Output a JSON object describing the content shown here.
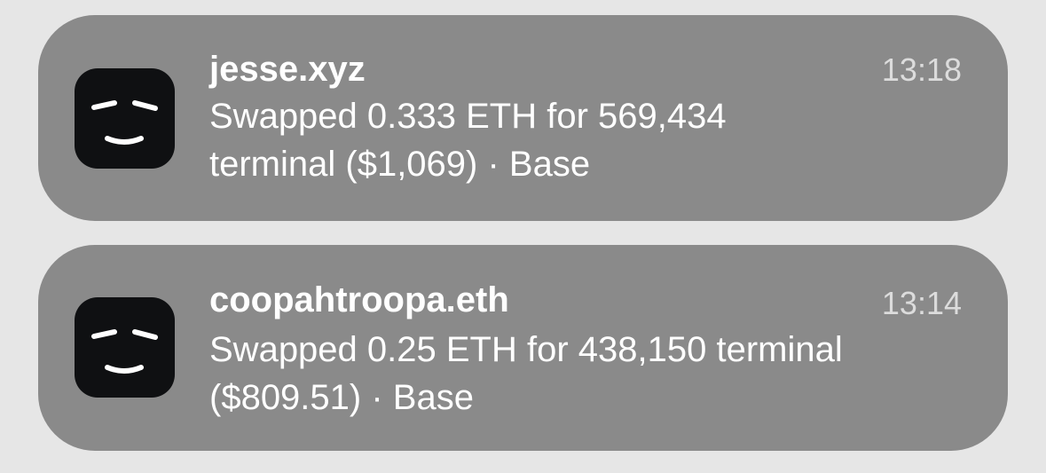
{
  "notifications": [
    {
      "title": "jesse.xyz",
      "time": "13:18",
      "body_line1": "Swapped 0.333 ETH for 569,434",
      "body_line2": "terminal ($1,069) · Base",
      "icon": "smiley-face-app-icon"
    },
    {
      "title": "coopahtroopa.eth",
      "time": "13:14",
      "body_line1": "Swapped 0.25 ETH for 438,150 terminal",
      "body_line2": "($809.51) · Base",
      "icon": "smiley-face-app-icon"
    }
  ],
  "colors": {
    "background": "#e6e6e6",
    "card": "#8a8a8a",
    "icon_bg": "#0f1012",
    "text": "#ffffff",
    "time_text": "#dcdcdc"
  }
}
